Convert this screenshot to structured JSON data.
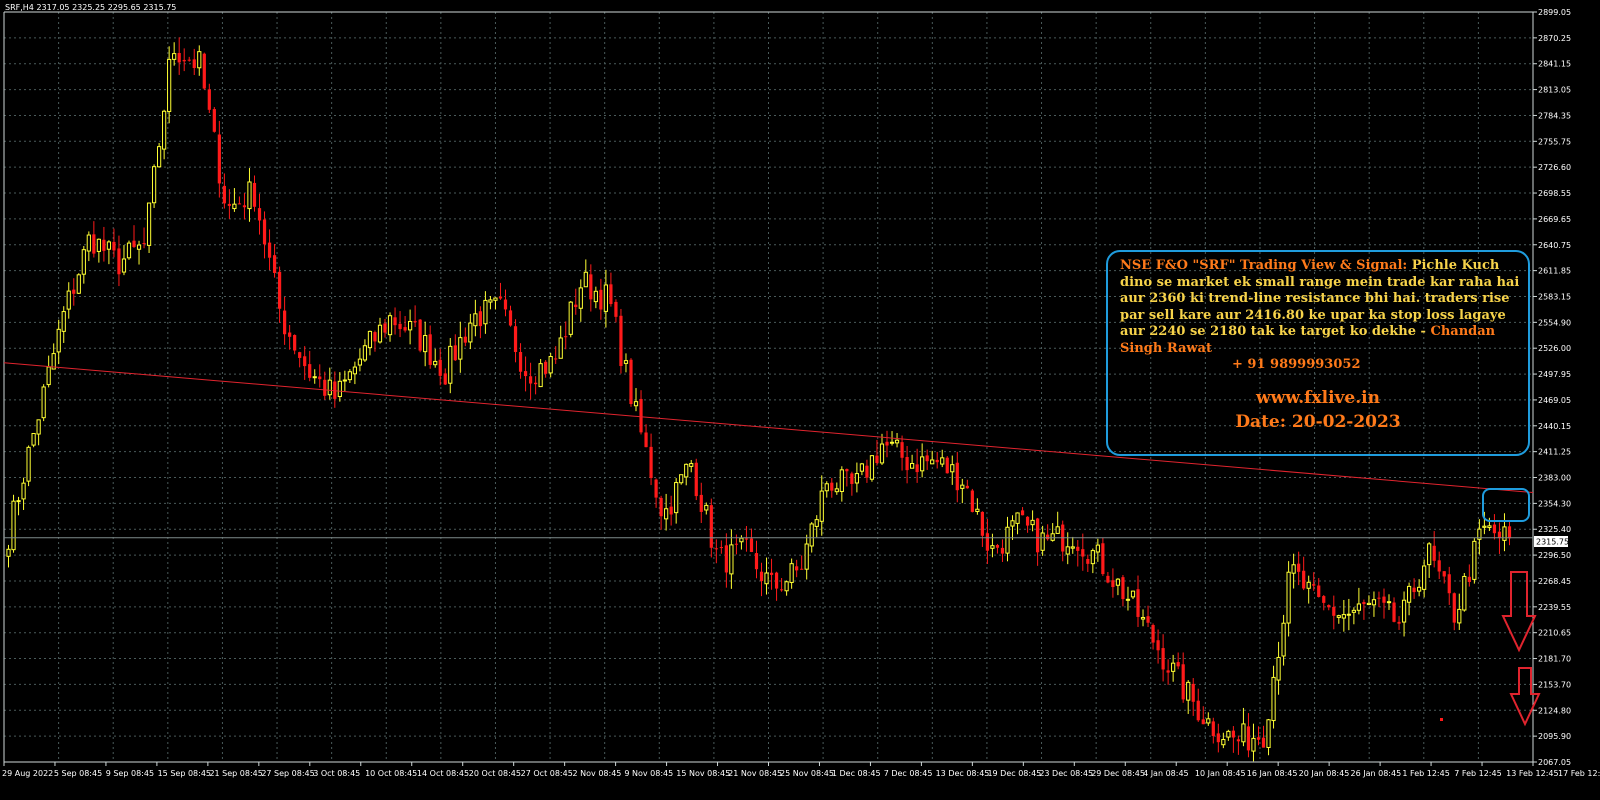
{
  "header": {
    "symbol": "SRF,H4",
    "ohlc": "2317.05 2325.25 2295.65 2315.75"
  },
  "current_price": "2315.75",
  "info_box": {
    "title": "NSE F&O \"SRF\" Trading View & Signal:",
    "body": "Pichle Kuch dino se market ek small range mein trade kar raha hai aur 2360 ki trend-line resistance bhi hai. traders rise par sell kare aur 2416.80 ke upar ka stop loss lagaye aur 2240 se 2180 tak ke target ko dekhe -",
    "author": "Chandan Singh Rawat",
    "phone": "+ 91 9899993052",
    "website": "www.fxlive.in",
    "date": "Date: 20-02-2023"
  },
  "colors": {
    "bull": "#ffff33",
    "bear": "#ff1a1a",
    "grid": "#4a5a5a",
    "trendline": "#e0242e",
    "box": "#1f9cdd"
  },
  "chart_data": {
    "type": "candlestick",
    "ylim": [
      2067.05,
      2899.05
    ],
    "y_ticks": [
      "2899.05",
      "2870.25",
      "2841.15",
      "2813.05",
      "2784.35",
      "2755.75",
      "2726.60",
      "2698.55",
      "2669.65",
      "2640.75",
      "2611.85",
      "2583.15",
      "2554.90",
      "2526.00",
      "2497.95",
      "2469.05",
      "2440.15",
      "2411.25",
      "2383.00",
      "2354.30",
      "2325.40",
      "2296.50",
      "2268.45",
      "2239.55",
      "2210.65",
      "2181.70",
      "2153.70",
      "2124.80",
      "2095.90",
      "2067.05"
    ],
    "x_ticks": [
      "29 Aug 2022",
      "5 Sep 08:45",
      "9 Sep 08:45",
      "15 Sep 08:45",
      "21 Sep 08:45",
      "27 Sep 08:45",
      "3 Oct 08:45",
      "10 Oct 08:45",
      "14 Oct 08:45",
      "20 Oct 08:45",
      "27 Oct 08:45",
      "2 Nov 08:45",
      "9 Nov 08:45",
      "15 Nov 08:45",
      "21 Nov 08:45",
      "25 Nov 08:45",
      "1 Dec 08:45",
      "7 Dec 08:45",
      "13 Dec 08:45",
      "19 Dec 08:45",
      "23 Dec 08:45",
      "29 Dec 08:45",
      "4 Jan 08:45",
      "10 Jan 08:45",
      "16 Jan 08:45",
      "20 Jan 08:45",
      "26 Jan 08:45",
      "1 Feb 12:45",
      "7 Feb 12:45",
      "13 Feb 12:45",
      "17 Feb 12:45"
    ],
    "close_anchors": [
      2320,
      2440,
      2560,
      2650,
      2620,
      2640,
      2860,
      2840,
      2680,
      2700,
      2560,
      2500,
      2470,
      2520,
      2560,
      2540,
      2500,
      2560,
      2570,
      2500,
      2510,
      2600,
      2580,
      2450,
      2340,
      2400,
      2290,
      2300,
      2260,
      2280,
      2380,
      2370,
      2420,
      2400,
      2400,
      2380,
      2300,
      2330,
      2310,
      2320,
      2290,
      2250,
      2200,
      2150,
      2110,
      2090,
      2100,
      2280,
      2240,
      2230,
      2240,
      2220,
      2300,
      2230,
      2325,
      2313
    ],
    "trendline": {
      "x1": "29 Aug 2022",
      "y1": 2510,
      "x2": "17 Feb 12:45",
      "y2": 2366
    }
  }
}
